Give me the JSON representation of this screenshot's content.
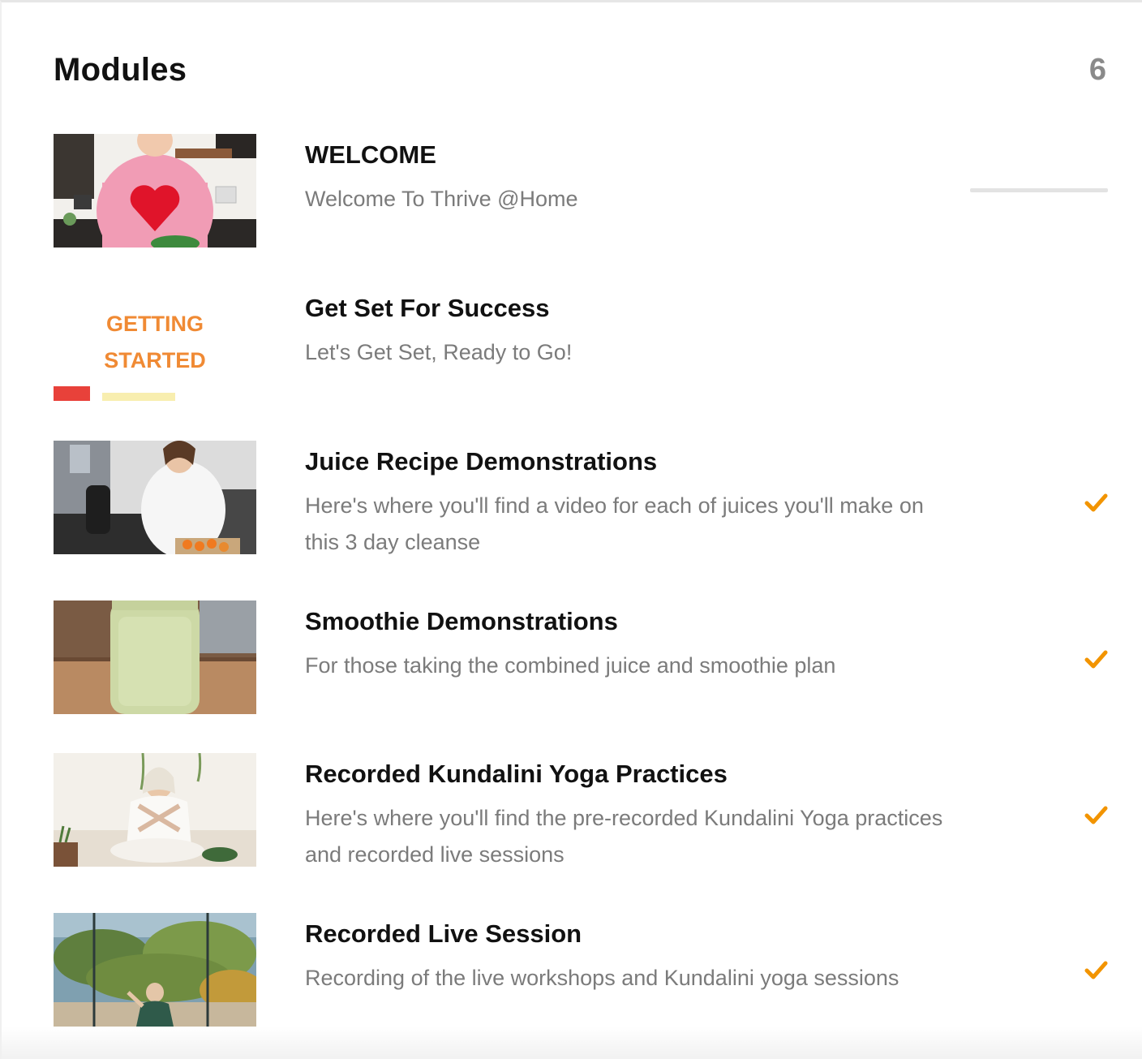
{
  "header": {
    "title": "Modules",
    "count": "6"
  },
  "colors": {
    "accent": "#f29400",
    "title_text": "#111111",
    "desc_text": "#7b7b7b",
    "count_text": "#8a8a8a",
    "progress_track": "#e3e3e3"
  },
  "modules": [
    {
      "title": "WELCOME",
      "description": "Welcome To Thrive @Home",
      "thumbnail": "woman-heart-sweater-kitchen",
      "status": "in-progress",
      "progress": 0
    },
    {
      "title": "Get Set For Success",
      "description": "Let's Get Set, Ready to Go!",
      "thumbnail": "getting-started-graphic",
      "thumbnail_text": [
        "GETTING",
        "STARTED"
      ],
      "status": "none"
    },
    {
      "title": "Juice Recipe Demonstrations",
      "description": "Here's where you'll find a video for each of juices you'll make on this 3 day cleanse",
      "thumbnail": "woman-juicing-carrots",
      "status": "complete",
      "status_icon": "check-icon"
    },
    {
      "title": "Smoothie Demonstrations",
      "description": "For those taking the combined juice and smoothie plan",
      "thumbnail": "green-smoothie-jar",
      "status": "complete",
      "status_icon": "check-icon"
    },
    {
      "title": "Recorded Kundalini Yoga Practices",
      "description": "Here's where you'll find the pre-recorded Kundalini Yoga practices and recorded live sessions",
      "thumbnail": "woman-yoga-seated",
      "status": "complete",
      "status_icon": "check-icon"
    },
    {
      "title": "Recorded Live Session",
      "description": "Recording of the live workshops and Kundalini yoga sessions",
      "thumbnail": "woman-yoga-window-garden",
      "status": "complete",
      "status_icon": "check-icon"
    }
  ]
}
